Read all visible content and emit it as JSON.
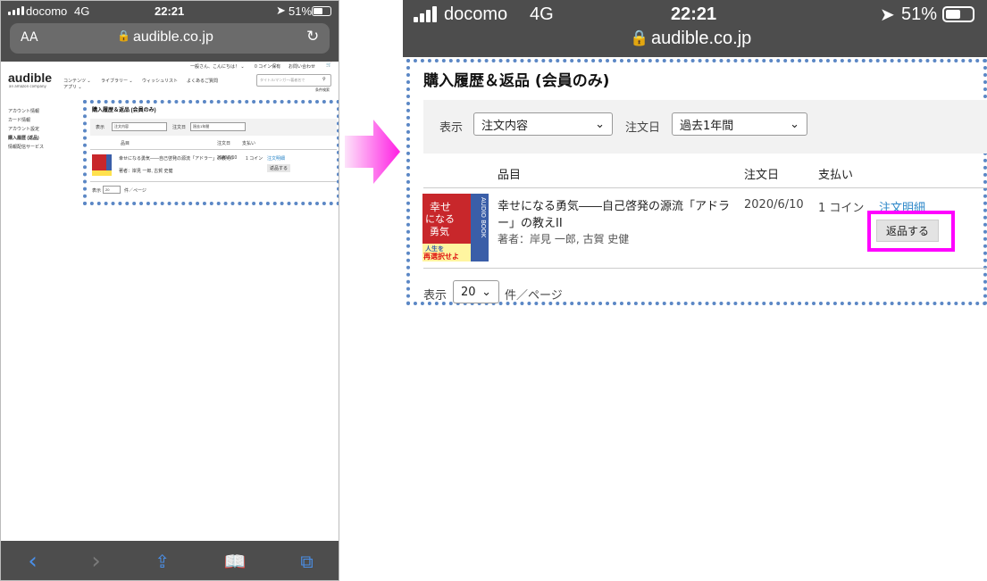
{
  "status": {
    "carrier": "docomo",
    "network": "4G",
    "time": "22:21",
    "battery": "51%"
  },
  "browser": {
    "text_size_label": "AA",
    "url": "audible.co.jp"
  },
  "site": {
    "logo": "audible",
    "logo_sub": "an amazon company",
    "nav": [
      "コンテンツ ⌄",
      "ライブラリー ⌄",
      "ウィッシュリスト",
      "よくあるご質問"
    ],
    "nav_sub": "アプリ ⌄",
    "greeting": "一般さん、こんにちは！ ⌄",
    "coin_info": "0 コイン保有",
    "help": "お問い合わせ",
    "search_placeholder": "タイトル/マンガー/著者名で",
    "under_search": "条件検索",
    "sidebar": [
      "アカウント情報",
      "カード情報",
      "アカウント設定",
      "購入履歴 (返品)",
      "情報配信サービス"
    ]
  },
  "purchase": {
    "title": "購入履歴＆返品 (会員のみ)",
    "filter_label": "表示",
    "filter_value": "注文内容",
    "date_label": "注文日",
    "date_value": "過去1年間",
    "col_item": "品目",
    "col_date": "注文日",
    "col_payment": "支払い",
    "row": {
      "title": "幸せになる勇気――自己啓発の源流「アドラー」の教えII",
      "author": "著者：岸見 一郎, 古賀 史健",
      "date": "2020/6/10",
      "payment": "1 コイン",
      "detail_link": "注文明細",
      "return_button": "返品する"
    },
    "per_page_label": "表示",
    "per_page_value": "20",
    "per_page_suffix": "件／ページ"
  },
  "cover": {
    "line1": "幸せ",
    "line2": "になる",
    "line3": "勇気",
    "side": "AUDIO BOOK",
    "bottom1": "人生を",
    "bottom2": "再選択せよ"
  },
  "colors": {
    "highlight": "#ff00ff",
    "dashed": "#5b87c5",
    "link": "#2b86c8",
    "status_bar": "#4d4d4d"
  }
}
